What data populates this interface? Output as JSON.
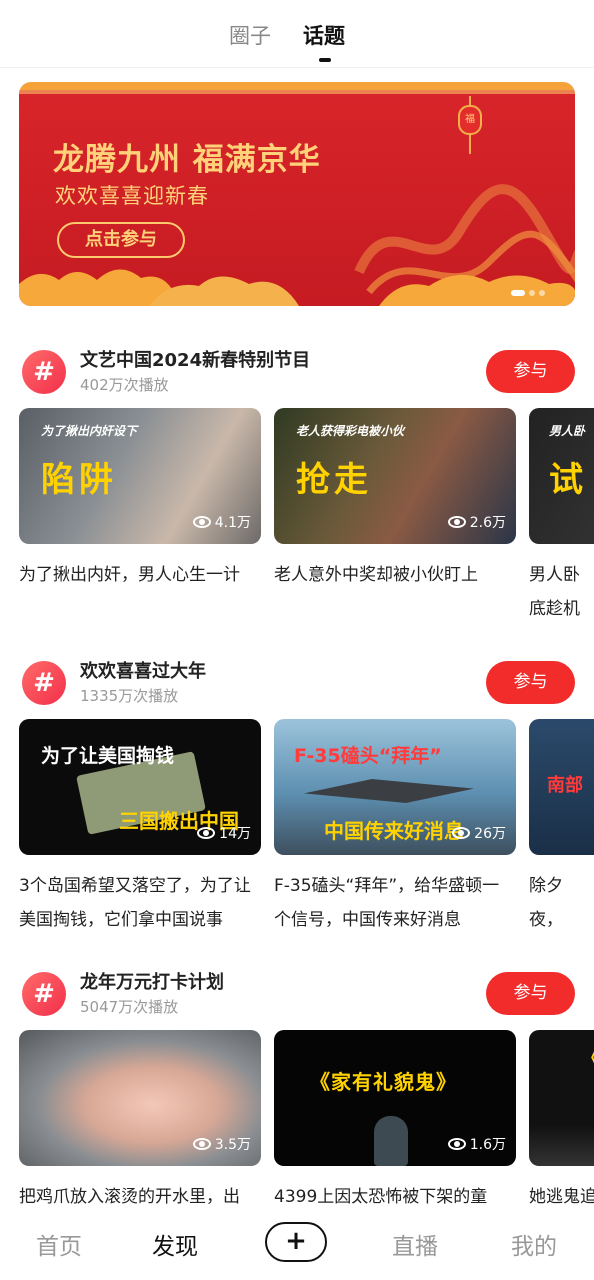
{
  "top_tabs": {
    "circle": "圈子",
    "topic": "话题"
  },
  "banner": {
    "title": "龙腾九州 福满京华",
    "subtitle": "欢欢喜喜迎新春",
    "button": "点击参与",
    "lantern_char": "福"
  },
  "sections": [
    {
      "title": "文艺中国2024新春特别节目",
      "plays": "402万次播放",
      "join": "参与",
      "cards": [
        {
          "caption": "为了揪出内奸设下",
          "big": "陷阱",
          "views": "4.1万",
          "title": "为了揪出内奸，男人心生一计"
        },
        {
          "caption": "老人获得彩电被小伙",
          "big": "抢走",
          "views": "2.6万",
          "title": "老人意外中奖却被小伙盯上"
        },
        {
          "caption": "男人卧",
          "big": "试",
          "views": "",
          "title": "男人卧底趁机试探"
        }
      ]
    },
    {
      "title": "欢欢喜喜过大年",
      "plays": "1335万次播放",
      "join": "参与",
      "cards": [
        {
          "caption": "为了让美国掏钱",
          "big": "三国搬出中国",
          "views": "14万",
          "title": "3个岛国希望又落空了，为了让美国掏钱，它们拿中国说事"
        },
        {
          "caption": "F-35磕头“拜年”",
          "big": "中国传来好消息",
          "views": "26万",
          "title": "F-35磕头“拜年”，给华盛顿一个信号，中国传来好消息"
        },
        {
          "caption": "南部",
          "big": "",
          "views": "",
          "title": "除夕夜，息，随时"
        }
      ]
    },
    {
      "title": "龙年万元打卡计划",
      "plays": "5047万次播放",
      "join": "参与",
      "cards": [
        {
          "caption": "",
          "big": "",
          "views": "3.5万",
          "title": "把鸡爪放入滚烫的开水里，出"
        },
        {
          "caption": "",
          "big": "《家有礼貌鬼》",
          "views": "1.6万",
          "title": "4399上因太恐怖被下架的童"
        },
        {
          "caption": "",
          "big": "《",
          "views": "",
          "title": "她逃鬼追"
        }
      ]
    }
  ],
  "bottom_nav": {
    "home": "首页",
    "discover": "发现",
    "add": "+",
    "live": "直播",
    "mine": "我的"
  },
  "colors": {
    "accent": "#f22b2b",
    "banner_red": "#d8252a",
    "banner_gold": "#ffd27a"
  }
}
